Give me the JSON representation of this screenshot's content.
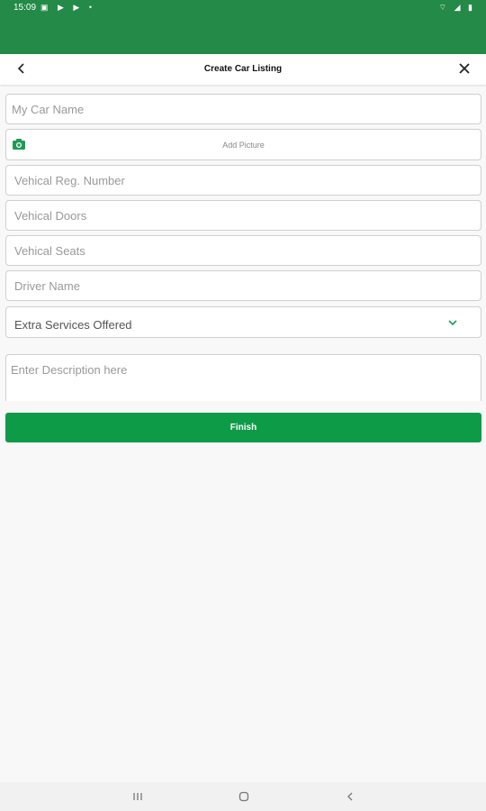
{
  "status_bar": {
    "time": "15:09",
    "left_icons": "▣ ▶ ▶ •",
    "right_icons": "⌔ ◢ ▮"
  },
  "app_bar": {
    "title": "Create Car Listing",
    "back_icon": "chevron-left-icon",
    "close_icon": "close-icon"
  },
  "form": {
    "car_name_placeholder": "My Car Name",
    "add_picture_label": "Add Picture",
    "reg_number_placeholder": "Vehical Reg. Number",
    "doors_placeholder": "Vehical Doors",
    "seats_placeholder": "Vehical Seats",
    "driver_name_placeholder": "Driver Name",
    "extra_services_label": "Extra Services Offered",
    "description_placeholder": "Enter Description here",
    "finish_label": "Finish"
  },
  "colors": {
    "status_bar": "#238a47",
    "accent": "#0e9b47",
    "camera_icon": "#1f9a55",
    "chevron": "#1f9a55"
  }
}
